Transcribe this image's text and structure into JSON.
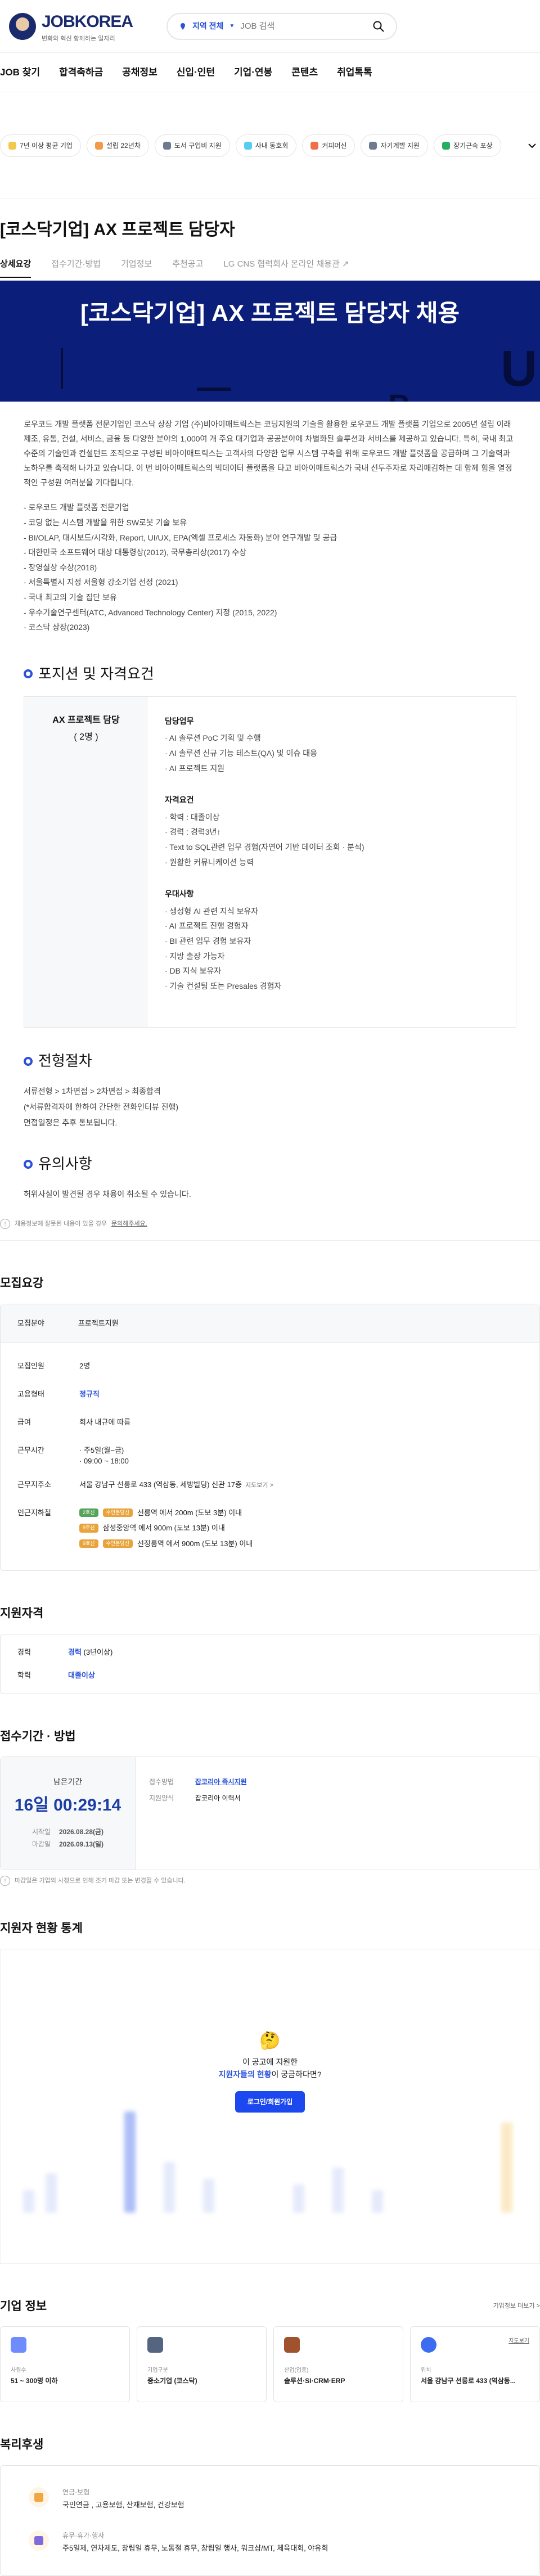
{
  "header": {
    "logo": "JOBKOREA",
    "logo_sub": "변화와 혁신 함께하는 일자리",
    "location": "지역 전체",
    "search_placeholder": "JOB 검색"
  },
  "gnb": [
    "JOB 찾기",
    "합격축하금",
    "공채정보",
    "신입·인턴",
    "기업·연봉",
    "콘텐츠",
    "취업톡톡"
  ],
  "tags": [
    {
      "label": "7년 이상 평균 기업",
      "color": "#f2c94c"
    },
    {
      "label": "설립 22년차",
      "color": "#f2994a"
    },
    {
      "label": "도서 구입비 지원",
      "color": "#6e7b8f"
    },
    {
      "label": "사내 동호회",
      "color": "#56ccf2"
    },
    {
      "label": "커피머신",
      "color": "#f26d4a"
    },
    {
      "label": "자기계발 지원",
      "color": "#6e7b8f"
    },
    {
      "label": "장기근속 포상",
      "color": "#27ae60"
    }
  ],
  "title": "[코스닥기업] AX 프로젝트 담당자",
  "tabs": [
    {
      "label": "상세요강",
      "on": true
    },
    {
      "label": "접수기간·방법"
    },
    {
      "label": "기업정보"
    },
    {
      "label": "추천공고"
    },
    {
      "label": "LG CNS 협력회사 온라인 채용관 ↗"
    }
  ],
  "banner_title": "[코스닥기업] AX 프로젝트 담당자 채용",
  "intro": "로우코드 개발 플랫폼 전문기업인 코스닥 상장 기업 (주)비아이매트릭스는 코딩지원의 기술을 활용한 로우코드 개발 플랫폼 기업으로 2005년 설립 이래 제조, 유통, 건설, 서비스, 금융 등 다양한 분야의 1,000여 개 주요 대기업과 공공분야에 차별화된 솔루션과 서비스를 제공하고 있습니다. 특히, 국내 최고 수준의 기술인과 컨설턴트 조직으로 구성된 비아이매트릭스는 고객사의 다양한 업무 시스템 구축을 위해 로우코드 개발 플랫폼을 공급하며 그 기술력과 노하우를 축적해 나가고 있습니다. 이 번 비아이매트릭스의 빅데이터 플랫폼을 타고 비아이매트릭스가 국내 선두주자로 자리매김하는 데 함께 힘을 열정적인 구성원 여러분을 기다립니다.",
  "history": [
    "- 로우코드 개발 플랫폼 전문기업",
    "- 코딩 없는 시스템 개발을 위한 SW로봇 기술 보유",
    "- BI/OLAP, 대시보드/시각화, Report, UI/UX, EPA(엑셀 프로세스 자동화) 분야 연구개발 및 공급",
    "- 대한민국 소프트웨어 대상 대통령상(2012), 국무총리상(2017) 수상",
    "- 장영실상 수상(2018)",
    "- 서울특별시 지정 서울형 강소기업 선정 (2021)",
    "- 국내 최고의 기술 집단 보유",
    "- 우수기술연구센터(ATC, Advanced Technology Center) 지정 (2015, 2022)",
    "- 코스닥 상장(2023)"
  ],
  "position_title": "포지션 및 자격요건",
  "position": {
    "name": "AX 프로젝트 담당",
    "count": "( 2명 )",
    "groups": [
      {
        "title": "담당업무",
        "items": [
          "· AI 솔루션 PoC 기획 및 수행",
          "· AI 솔루션 신규 기능 테스트(QA) 및 이슈 대응",
          "· AI 프로젝트 지원"
        ]
      },
      {
        "title": "자격요건",
        "items": [
          "· 학력 : 대졸이상",
          "· 경력 : 경력3년↑",
          "· Text to SQL관련 업무 경험(자연어 기반 데이터 조회 · 분석)",
          "· 원활한 커뮤니케이션 능력"
        ]
      },
      {
        "title": "우대사항",
        "items": [
          "· 생성형 AI 관련 지식 보유자",
          "· AI 프로젝트 진행 경험자",
          "· BI 관련 업무 경험 보유자",
          "· 지방 출장 가능자",
          "· DB 지식 보유자",
          "· 기술 컨설팅 또는 Presales 경험자"
        ]
      }
    ]
  },
  "process_title": "전형절차",
  "process": [
    "서류전형 > 1차면접 > 2차면접 > 최종합격",
    "(*서류합격자에 한하여 간단한 전화인터뷰 진행)",
    "면접일정은 추후 통보됩니다."
  ],
  "notice_title": "유의사항",
  "notice": [
    "허위사실이 발견될 경우 채용이 취소될 수 있습니다."
  ],
  "fraud_note": "채용정보에 잘못된 내용이 있을 경우",
  "fraud_link": "문의해주세요.",
  "req": {
    "title": "모집요강",
    "field_key": "모집분야",
    "field_val": "프로젝트지원",
    "rows": [
      {
        "k": "모집인원",
        "v": "2명"
      },
      {
        "k": "고용형태",
        "v": "정규직"
      },
      {
        "k": "급여",
        "v": "회사 내규에 따름"
      },
      {
        "k": "근무시간",
        "v1": "· 주5일(월~금)",
        "v2": "· 09:00 ~ 18:00"
      },
      {
        "k": "근무지주소",
        "v": "서울 강남구 선릉로 433 (역삼동, 세방빌딩) 신관 17층",
        "link": "지도보기 >"
      }
    ],
    "station_key": "인근지하철",
    "stations": [
      {
        "b1": "2호선",
        "b2": "수인분당선",
        "t": "선릉역 에서 200m (도보 3분) 이내"
      },
      {
        "b1": "9호선",
        "b2": "",
        "t": "삼성중앙역 에서 900m (도보 13분) 이내"
      },
      {
        "b1": "9호선",
        "b2": "수인분당선",
        "t": "선정릉역 에서 900m (도보 13분) 이내"
      }
    ]
  },
  "qual": {
    "title": "지원자격",
    "rows": [
      {
        "k": "경력",
        "v": "경력",
        "s": " (3년이상)"
      },
      {
        "k": "학력",
        "v": "대졸이상",
        "s": ""
      }
    ]
  },
  "period": {
    "title": "접수기간 · 방법",
    "left_label": "남은기간",
    "dday": "16일 00:29:14",
    "start_k": "시작일",
    "start": "2026.08.28(금)",
    "end_k": "마감일",
    "end": "2026.09.13(일)",
    "method_k": "접수방법",
    "method": "잡코리아 즉시지원",
    "form_k": "지원양식",
    "form": "잡코리아 이력서",
    "note": "마감일은 기업의 사정으로 인해 조기 마감 또는 변경될 수 있습니다."
  },
  "stats": {
    "title": "지원자 현황 통계",
    "q1": "이 공고에 지원한",
    "q2b": "지원자들의 현황",
    "q2": "이 궁금하다면?",
    "btn": "로그인/회원가입"
  },
  "company": {
    "title": "기업 정보",
    "more": "기업정보 더보기 >",
    "cards": [
      {
        "k": "사원수",
        "v": "51 ~ 300명 이하",
        "c": "#6f8cff"
      },
      {
        "k": "기업구분",
        "v": "중소기업 (코스닥)",
        "c": "#55657f"
      },
      {
        "k": "산업(업종)",
        "v": "솔루션·SI·CRM·ERP",
        "c": "#a0522d"
      },
      {
        "k": "위치",
        "v": "서울 강남구 선릉로 433 (역삼동...",
        "c": "#3b6cf2",
        "link": "지도보기"
      }
    ]
  },
  "benefits": {
    "title": "복리후생",
    "rows": [
      {
        "k": "연금·보험",
        "v": "국민연금 , 고용보험, 산재보험, 건강보험"
      },
      {
        "k": "휴무·휴가·행사",
        "v": "주5일제, 연차제도, 창립일 휴무, 노동절 휴무, 창립일 행사, 워크샵/MT, 체육대회, 야유회"
      }
    ]
  }
}
